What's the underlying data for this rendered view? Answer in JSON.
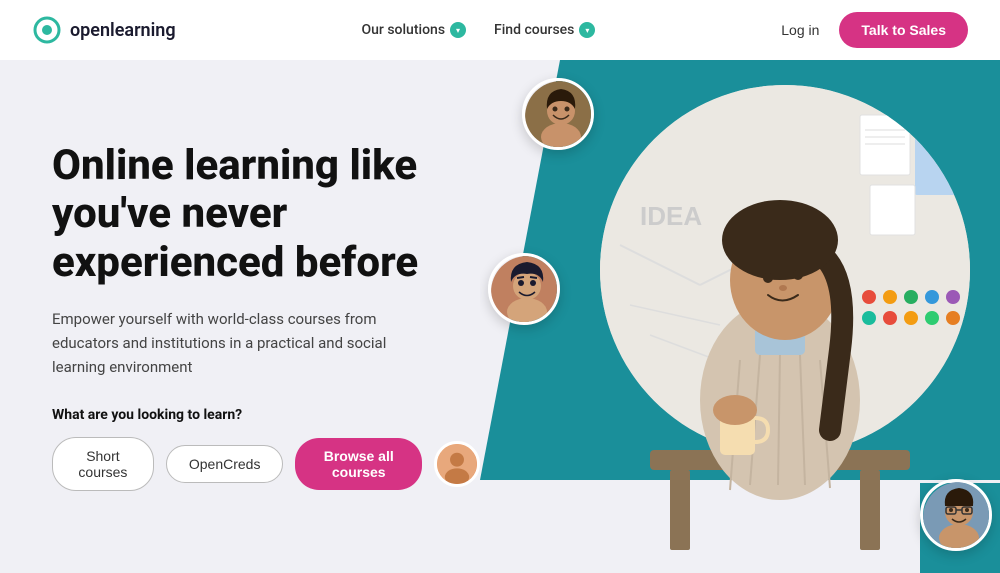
{
  "brand": {
    "logo_text": "openlearning",
    "logo_color": "#2db8a0"
  },
  "navbar": {
    "solutions_label": "Our solutions",
    "find_courses_label": "Find courses",
    "login_label": "Log in",
    "cta_label": "Talk to Sales"
  },
  "hero": {
    "headline": "Online learning like you've never experienced before",
    "subtext": "Empower yourself with world-class courses from educators and institutions in a practical and social learning environment",
    "cta_question": "What are you looking to learn?",
    "btn_short_courses": "Short courses",
    "btn_opencreds": "OpenCreds",
    "btn_browse": "Browse all courses"
  },
  "dots": [
    {
      "color": "#e74c3c"
    },
    {
      "color": "#f39c12"
    },
    {
      "color": "#f39c12"
    },
    {
      "color": "#27ae60"
    },
    {
      "color": "#2980b9"
    },
    {
      "color": "#e74c3c"
    },
    {
      "color": "#9b59b6"
    },
    {
      "color": "#27ae60"
    },
    {
      "color": "#e74c3c"
    },
    {
      "color": "#f39c12"
    }
  ]
}
